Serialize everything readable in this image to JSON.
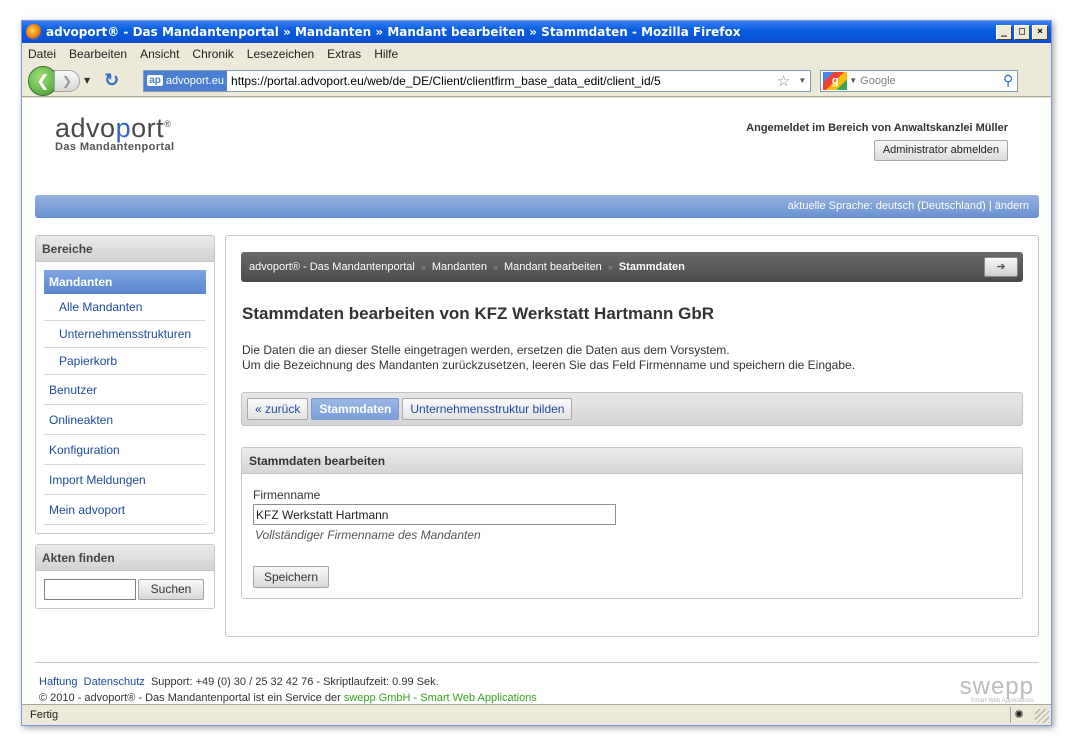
{
  "window": {
    "title": "advoport® - Das Mandantenportal » Mandanten » Mandant bearbeiten » Stammdaten - Mozilla Firefox",
    "buttons": [
      "_",
      "□",
      "×"
    ]
  },
  "menu": [
    "Datei",
    "Bearbeiten",
    "Ansicht",
    "Chronik",
    "Lesezeichen",
    "Extras",
    "Hilfe"
  ],
  "nav": {
    "back_icon": "back-arrow-icon",
    "site_short": "ap",
    "site_name": "advoport.eu",
    "url": "https://portal.advoport.eu/web/de_DE/Client/clientfirm_base_data_edit/client_id/5",
    "search_placeholder": "Google",
    "search_engine_letter": "g"
  },
  "header": {
    "logo_text_a": "advo",
    "logo_text_o": "p",
    "logo_text_b": "ort",
    "logo_reg": "®",
    "logo_tagline": "Das Mandantenportal",
    "login_info": "Angemeldet im Bereich von Anwaltskanzlei Müller",
    "logout_label": "Administrator abmelden",
    "language_bar": "aktuelle Sprache: deutsch (Deutschland) | ändern"
  },
  "sidebar": {
    "section_title": "Bereiche",
    "active": "Mandanten",
    "subitems": [
      "Alle Mandanten",
      "Unternehmensstrukturen",
      "Papierkorb"
    ],
    "items": [
      "Benutzer",
      "Onlineakten",
      "Konfiguration",
      "Import Meldungen",
      "Mein advoport"
    ],
    "search_title": "Akten finden",
    "search_button": "Suchen",
    "search_value": ""
  },
  "breadcrumb": {
    "items": [
      "advoport® - Das Mandantenportal",
      "Mandanten",
      "Mandant bearbeiten"
    ],
    "current": "Stammdaten",
    "separator": "»"
  },
  "main": {
    "title": "Stammdaten bearbeiten von KFZ Werkstatt Hartmann GbR",
    "desc_line1": "Die Daten die an dieser Stelle eingetragen werden, ersetzen die Daten aus dem Vorsystem.",
    "desc_line2": "Um die Bezeichnung des Mandanten zurückzusetzen, leeren Sie das Feld Firmenname und speichern die Eingabe.",
    "tabs": [
      {
        "label": "« zurück",
        "active": false
      },
      {
        "label": "Stammdaten",
        "active": true
      },
      {
        "label": "Unternehmensstruktur bilden",
        "active": false
      }
    ]
  },
  "form": {
    "title": "Stammdaten bearbeiten",
    "field_label": "Firmenname",
    "field_value": "KFZ Werkstatt Hartmann",
    "field_hint": "Vollständiger Firmenname des Mandanten",
    "save_label": "Speichern"
  },
  "footer": {
    "link_haftung": "Haftung",
    "link_datenschutz": "Datenschutz",
    "support_text": "Support: +49 (0) 30 / 25 32 42 76 - Skriptlaufzeit: 0.99 Sek.",
    "copyright": "© 2010 - advoport® - Das Mandantenportal ist ein Service der",
    "partner_link": "swepp GmbH - Smart Web Applications",
    "swepp_logo": "swepp",
    "swepp_sub": "Smart Web Applications"
  },
  "status": {
    "text": "Fertig"
  }
}
